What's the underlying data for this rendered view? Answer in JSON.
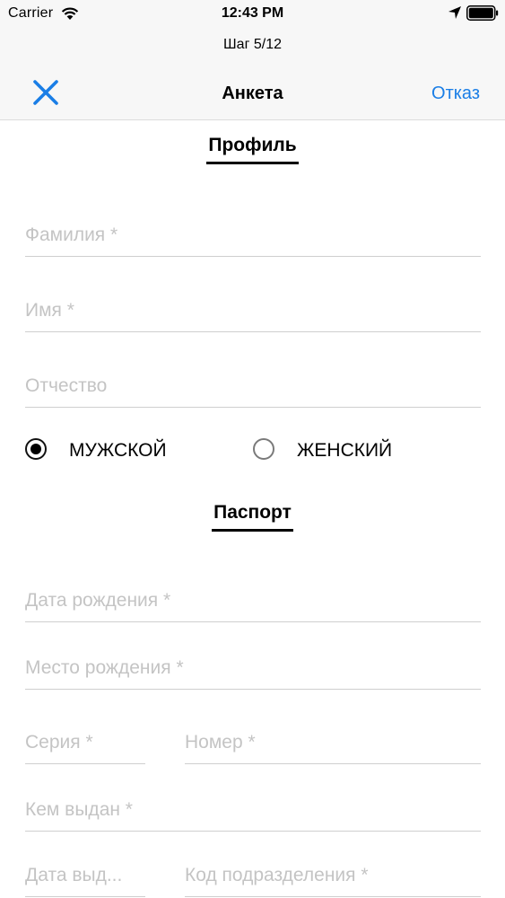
{
  "status_bar": {
    "carrier": "Carrier",
    "time": "12:43 PM"
  },
  "header": {
    "step": "Шаг 5/12",
    "title": "Анкета",
    "cancel_label": "Отказ",
    "close_icon": "close-icon",
    "accent_color": "#1a7ee6"
  },
  "profile": {
    "heading": "Профиль",
    "fields": {
      "last_name": {
        "value": "",
        "placeholder": "Фамилия *"
      },
      "first_name": {
        "value": "",
        "placeholder": "Имя *"
      },
      "patronymic": {
        "value": "",
        "placeholder": "Отчество"
      }
    },
    "gender": {
      "options": [
        "МУЖСКОЙ",
        "ЖЕНСКИЙ"
      ],
      "selected": "МУЖСКОЙ"
    }
  },
  "passport": {
    "heading": "Паспорт",
    "fields": {
      "birth_date": {
        "value": "",
        "placeholder": "Дата рождения *"
      },
      "birth_place": {
        "value": "",
        "placeholder": "Место рождения *"
      },
      "series": {
        "value": "",
        "placeholder": "Серия *"
      },
      "number": {
        "value": "",
        "placeholder": "Номер *"
      },
      "issued_by": {
        "value": "",
        "placeholder": "Кем выдан *"
      },
      "issue_date": {
        "value": "",
        "placeholder": "Дата выд..."
      },
      "department_code": {
        "value": "",
        "placeholder": "Код подразделения *"
      }
    }
  }
}
